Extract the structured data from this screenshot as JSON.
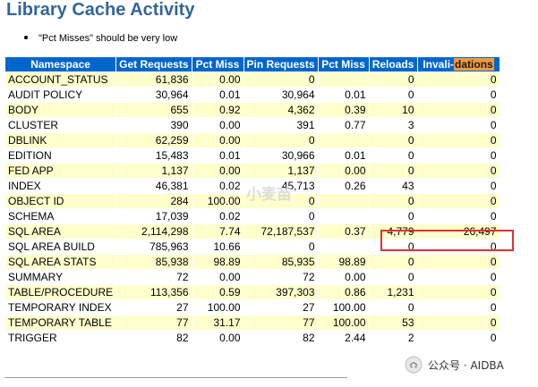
{
  "title": "Library Cache Activity",
  "note": "\"Pct Misses\" should be very low",
  "headers": {
    "namespace": "Namespace",
    "get_requests": "Get Requests",
    "pct_miss_get": "Pct Miss",
    "pin_requests": "Pin Requests",
    "pct_miss_pin": "Pct Miss",
    "reloads": "Reloads",
    "invalidations_prefix": "Invali-",
    "invalidations_highlight": "dations"
  },
  "rows": [
    {
      "namespace": "ACCOUNT_STATUS",
      "get_requests": "61,836",
      "pct_miss_get": "0.00",
      "pin_requests": "0",
      "pct_miss_pin": "",
      "reloads": "0",
      "invalidations": "0"
    },
    {
      "namespace": "AUDIT POLICY",
      "get_requests": "30,964",
      "pct_miss_get": "0.01",
      "pin_requests": "30,964",
      "pct_miss_pin": "0.01",
      "reloads": "0",
      "invalidations": "0"
    },
    {
      "namespace": "BODY",
      "get_requests": "655",
      "pct_miss_get": "0.92",
      "pin_requests": "4,362",
      "pct_miss_pin": "0.39",
      "reloads": "10",
      "invalidations": "0"
    },
    {
      "namespace": "CLUSTER",
      "get_requests": "390",
      "pct_miss_get": "0.00",
      "pin_requests": "391",
      "pct_miss_pin": "0.77",
      "reloads": "3",
      "invalidations": "0"
    },
    {
      "namespace": "DBLINK",
      "get_requests": "62,259",
      "pct_miss_get": "0.00",
      "pin_requests": "0",
      "pct_miss_pin": "",
      "reloads": "0",
      "invalidations": "0"
    },
    {
      "namespace": "EDITION",
      "get_requests": "15,483",
      "pct_miss_get": "0.01",
      "pin_requests": "30,966",
      "pct_miss_pin": "0.01",
      "reloads": "0",
      "invalidations": "0"
    },
    {
      "namespace": "FED APP",
      "get_requests": "1,137",
      "pct_miss_get": "0.00",
      "pin_requests": "1,137",
      "pct_miss_pin": "0.00",
      "reloads": "0",
      "invalidations": "0"
    },
    {
      "namespace": "INDEX",
      "get_requests": "46,381",
      "pct_miss_get": "0.02",
      "pin_requests": "45,713",
      "pct_miss_pin": "0.26",
      "reloads": "43",
      "invalidations": "0"
    },
    {
      "namespace": "OBJECT ID",
      "get_requests": "284",
      "pct_miss_get": "100.00",
      "pin_requests": "0",
      "pct_miss_pin": "",
      "reloads": "0",
      "invalidations": "0"
    },
    {
      "namespace": "SCHEMA",
      "get_requests": "17,039",
      "pct_miss_get": "0.02",
      "pin_requests": "0",
      "pct_miss_pin": "",
      "reloads": "0",
      "invalidations": "0"
    },
    {
      "namespace": "SQL AREA",
      "get_requests": "2,114,298",
      "pct_miss_get": "7.74",
      "pin_requests": "72,187,537",
      "pct_miss_pin": "0.37",
      "reloads": "4,779",
      "invalidations": "26,497"
    },
    {
      "namespace": "SQL AREA BUILD",
      "get_requests": "785,963",
      "pct_miss_get": "10.66",
      "pin_requests": "0",
      "pct_miss_pin": "",
      "reloads": "0",
      "invalidations": "0"
    },
    {
      "namespace": "SQL AREA STATS",
      "get_requests": "85,938",
      "pct_miss_get": "98.89",
      "pin_requests": "85,935",
      "pct_miss_pin": "98.89",
      "reloads": "0",
      "invalidations": "0"
    },
    {
      "namespace": "SUMMARY",
      "get_requests": "72",
      "pct_miss_get": "0.00",
      "pin_requests": "72",
      "pct_miss_pin": "0.00",
      "reloads": "0",
      "invalidations": "0"
    },
    {
      "namespace": "TABLE/PROCEDURE",
      "get_requests": "113,356",
      "pct_miss_get": "0.59",
      "pin_requests": "397,303",
      "pct_miss_pin": "0.86",
      "reloads": "1,231",
      "invalidations": "0"
    },
    {
      "namespace": "TEMPORARY INDEX",
      "get_requests": "27",
      "pct_miss_get": "100.00",
      "pin_requests": "27",
      "pct_miss_pin": "100.00",
      "reloads": "0",
      "invalidations": "0"
    },
    {
      "namespace": "TEMPORARY TABLE",
      "get_requests": "77",
      "pct_miss_get": "31.17",
      "pin_requests": "77",
      "pct_miss_pin": "100.00",
      "reloads": "53",
      "invalidations": "0"
    },
    {
      "namespace": "TRIGGER",
      "get_requests": "82",
      "pct_miss_get": "0.00",
      "pin_requests": "82",
      "pct_miss_pin": "2.44",
      "reloads": "2",
      "invalidations": "0"
    }
  ],
  "watermark_center": "小麦苗",
  "watermark_corner": "公众号 · AIDBA",
  "colors": {
    "header_bg": "#0066cc",
    "odd_row_bg": "#ffffcc",
    "title": "#336699",
    "highlight_border": "#e03131",
    "search_highlight": "#f29a3c"
  }
}
